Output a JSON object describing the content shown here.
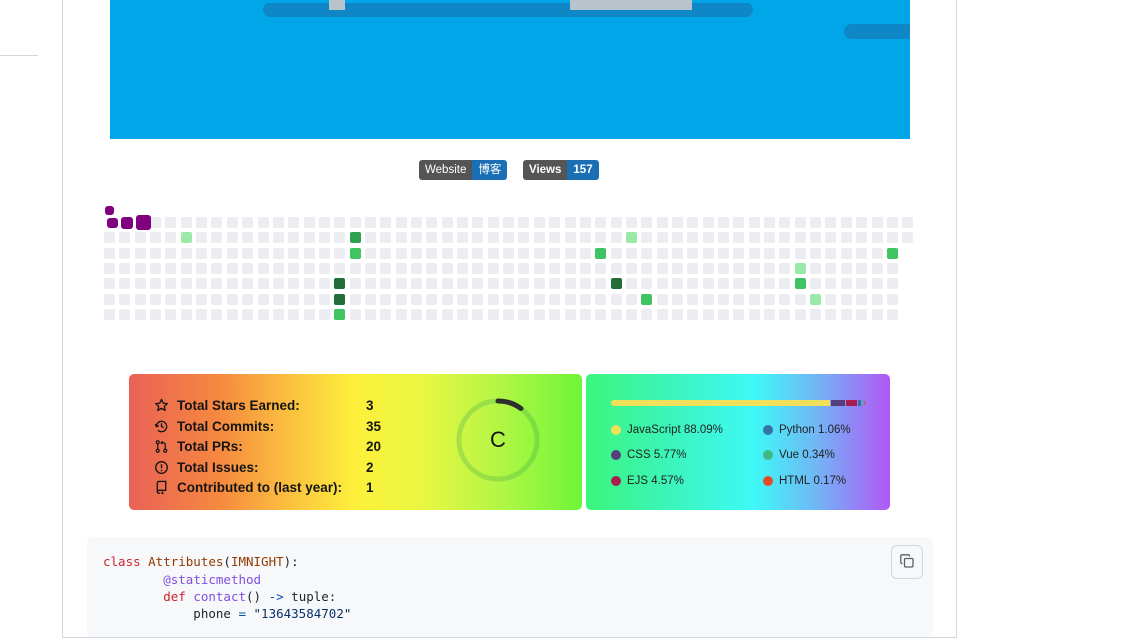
{
  "badges": {
    "website": {
      "label": "Website",
      "value": "博客"
    },
    "views": {
      "label": "Views",
      "value": "157"
    }
  },
  "colors": {
    "banner": "#00a6e8",
    "badge_label_bg": "#555555",
    "badge_value_bg": "#1a6fb4",
    "snake": "#800080"
  },
  "stats": {
    "rows": [
      {
        "icon": "star-icon",
        "label": "Total Stars Earned:",
        "value": "3"
      },
      {
        "icon": "history-icon",
        "label": "Total Commits:",
        "value": "35"
      },
      {
        "icon": "pull-request-icon",
        "label": "Total PRs:",
        "value": "20"
      },
      {
        "icon": "issue-icon",
        "label": "Total Issues:",
        "value": "2"
      },
      {
        "icon": "repo-icon",
        "label": "Contributed to (last year):",
        "value": "1"
      }
    ],
    "rank": "C",
    "rank_progress": 0.1
  },
  "languages": [
    {
      "name": "JavaScript",
      "percent": "88.09%",
      "value": 88.09,
      "color": "#f1e05a"
    },
    {
      "name": "Python",
      "percent": "1.06%",
      "value": 1.06,
      "color": "#3572A5"
    },
    {
      "name": "CSS",
      "percent": "5.77%",
      "value": 5.77,
      "color": "#563d7c"
    },
    {
      "name": "Vue",
      "percent": "0.34%",
      "value": 0.34,
      "color": "#41b883"
    },
    {
      "name": "EJS",
      "percent": "4.57%",
      "value": 4.57,
      "color": "#a91e50"
    },
    {
      "name": "HTML",
      "percent": "0.17%",
      "value": 0.17,
      "color": "#e34c26"
    }
  ],
  "code": {
    "lines": [
      [
        {
          "t": "class ",
          "c": "kw"
        },
        {
          "t": "Attributes",
          "c": "cls"
        },
        {
          "t": "(",
          "c": ""
        },
        {
          "t": "IMNIGHT",
          "c": "cls"
        },
        {
          "t": "):",
          "c": ""
        }
      ],
      [
        {
          "t": "        ",
          "c": ""
        },
        {
          "t": "@staticmethod",
          "c": "dec"
        }
      ],
      [
        {
          "t": "        ",
          "c": ""
        },
        {
          "t": "def ",
          "c": "kw"
        },
        {
          "t": "contact",
          "c": "fn"
        },
        {
          "t": "() ",
          "c": ""
        },
        {
          "t": "->",
          "c": "op"
        },
        {
          "t": " tuple:",
          "c": ""
        }
      ],
      [
        {
          "t": "            phone ",
          "c": ""
        },
        {
          "t": "=",
          "c": "op"
        },
        {
          "t": " ",
          "c": ""
        },
        {
          "t": "\"13643584702\"",
          "c": "str"
        }
      ]
    ],
    "copy_icon": "copy-icon"
  }
}
